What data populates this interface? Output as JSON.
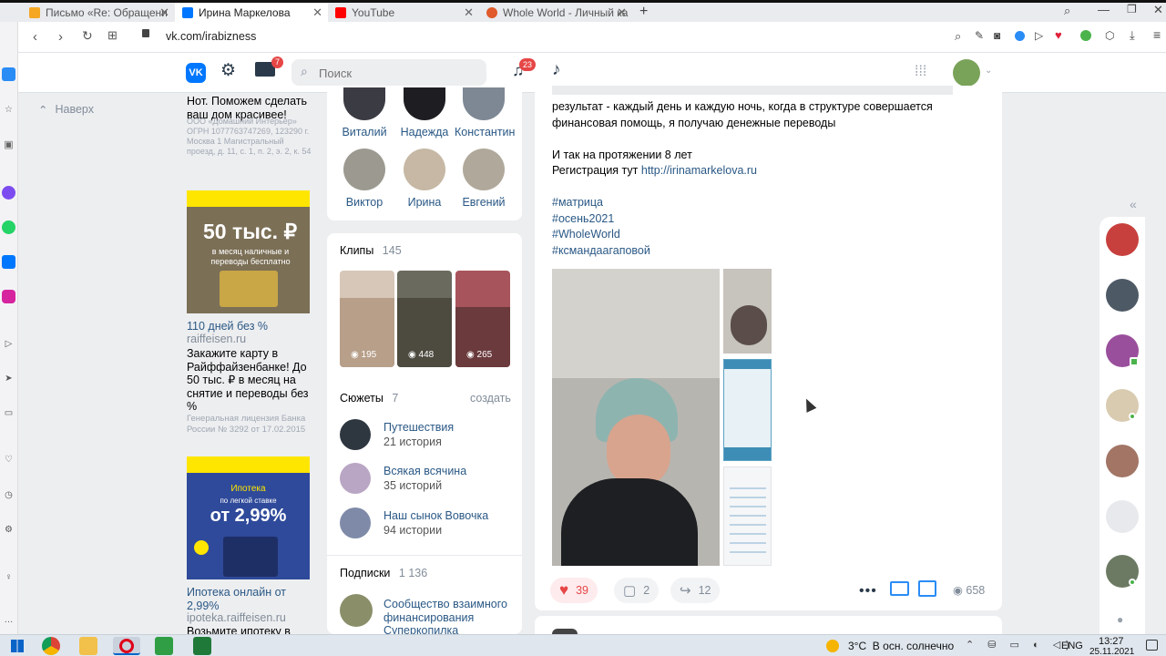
{
  "browser": {
    "tabs": [
      {
        "title": "Письмо «Re: Обращени",
        "favicon": "mail-icon",
        "color": "#f5a623"
      },
      {
        "title": "Ирина Маркелова",
        "favicon": "vk-icon",
        "color": "#0077ff"
      },
      {
        "title": "YouTube",
        "favicon": "youtube-icon",
        "color": "#ff0000"
      },
      {
        "title": "Whole World - Личный ка",
        "favicon": "ww-icon",
        "color": "#e05a2b"
      }
    ],
    "new_tab": "+",
    "url": "vk.com/irabizness"
  },
  "vk_header": {
    "search_placeholder": "Поиск",
    "messages_badge": "7",
    "notifications_badge": "23"
  },
  "left_nav": {
    "back_to_top": "Наверх"
  },
  "ads": [
    {
      "top_text": "Нот. Поможем сделать ваш дом красивее!",
      "legal": "ООО «Домашний Интерьер» ОГРН 1077763747269, 123290 г. Москва 1 Магистральный проезд, д. 11, с. 1, п. 2, э. 2, к. 54"
    },
    {
      "banner_line1": "50 тыс. ₽",
      "banner_line2": "в месяц наличные и переводы бесплатно",
      "title": "110 дней без %",
      "domain": "raiffeisen.ru",
      "text": "Закажите карту в Райффайзенбанке! До 50 тыс. ₽ в месяц на снятие и переводы без %",
      "legal": "Генеральная лицензия Банка России № 3292 от 17.02.2015"
    },
    {
      "banner_line1": "Ипотека",
      "banner_line2": "по легкой ставке",
      "banner_rate": "от 2,99%",
      "title": "Ипотека онлайн от 2,99%",
      "domain": "ipoteka.raiffeisen.ru",
      "text": "Возьмите ипотеку в"
    }
  ],
  "friends": [
    {
      "name": "Виталий"
    },
    {
      "name": "Надежда"
    },
    {
      "name": "Константин"
    },
    {
      "name": "Виктор"
    },
    {
      "name": "Ирина"
    },
    {
      "name": "Евгений"
    }
  ],
  "clips": {
    "title": "Клипы",
    "count": "145",
    "items": [
      {
        "views": "195"
      },
      {
        "views": "448"
      },
      {
        "views": "265"
      }
    ]
  },
  "stories": {
    "title": "Сюжеты",
    "count": "7",
    "create": "создать",
    "items": [
      {
        "title": "Путешествия",
        "sub": "21 история"
      },
      {
        "title": "Всякая всячина",
        "sub": "35 историй"
      },
      {
        "title": "Наш сынок Вовочка",
        "sub": "94 истории"
      }
    ]
  },
  "subscriptions": {
    "title": "Подписки",
    "count": "1 136",
    "item": "Сообщество взаимного финансирования Суперкопилка"
  },
  "post": {
    "line_partial": "результат - каждый день и каждую ночь, когда в структуре совершается финансовая помощь, я получаю денежные переводы",
    "line_8years": "И так на протяжении 8 лет",
    "reg_label": "Регистрация тут",
    "reg_link": "http://irinamarkelova.ru",
    "hashtags": [
      "#матрица",
      "#осень2021",
      "#WholeWorld",
      "#ксмандаагаповой"
    ],
    "likes": "39",
    "comments": "2",
    "shares": "12",
    "views": "658"
  },
  "taskbar": {
    "weather": "3°C  В осн. солнечно",
    "lang": "ENG",
    "time": "13:27",
    "date": "25.11.2021"
  }
}
